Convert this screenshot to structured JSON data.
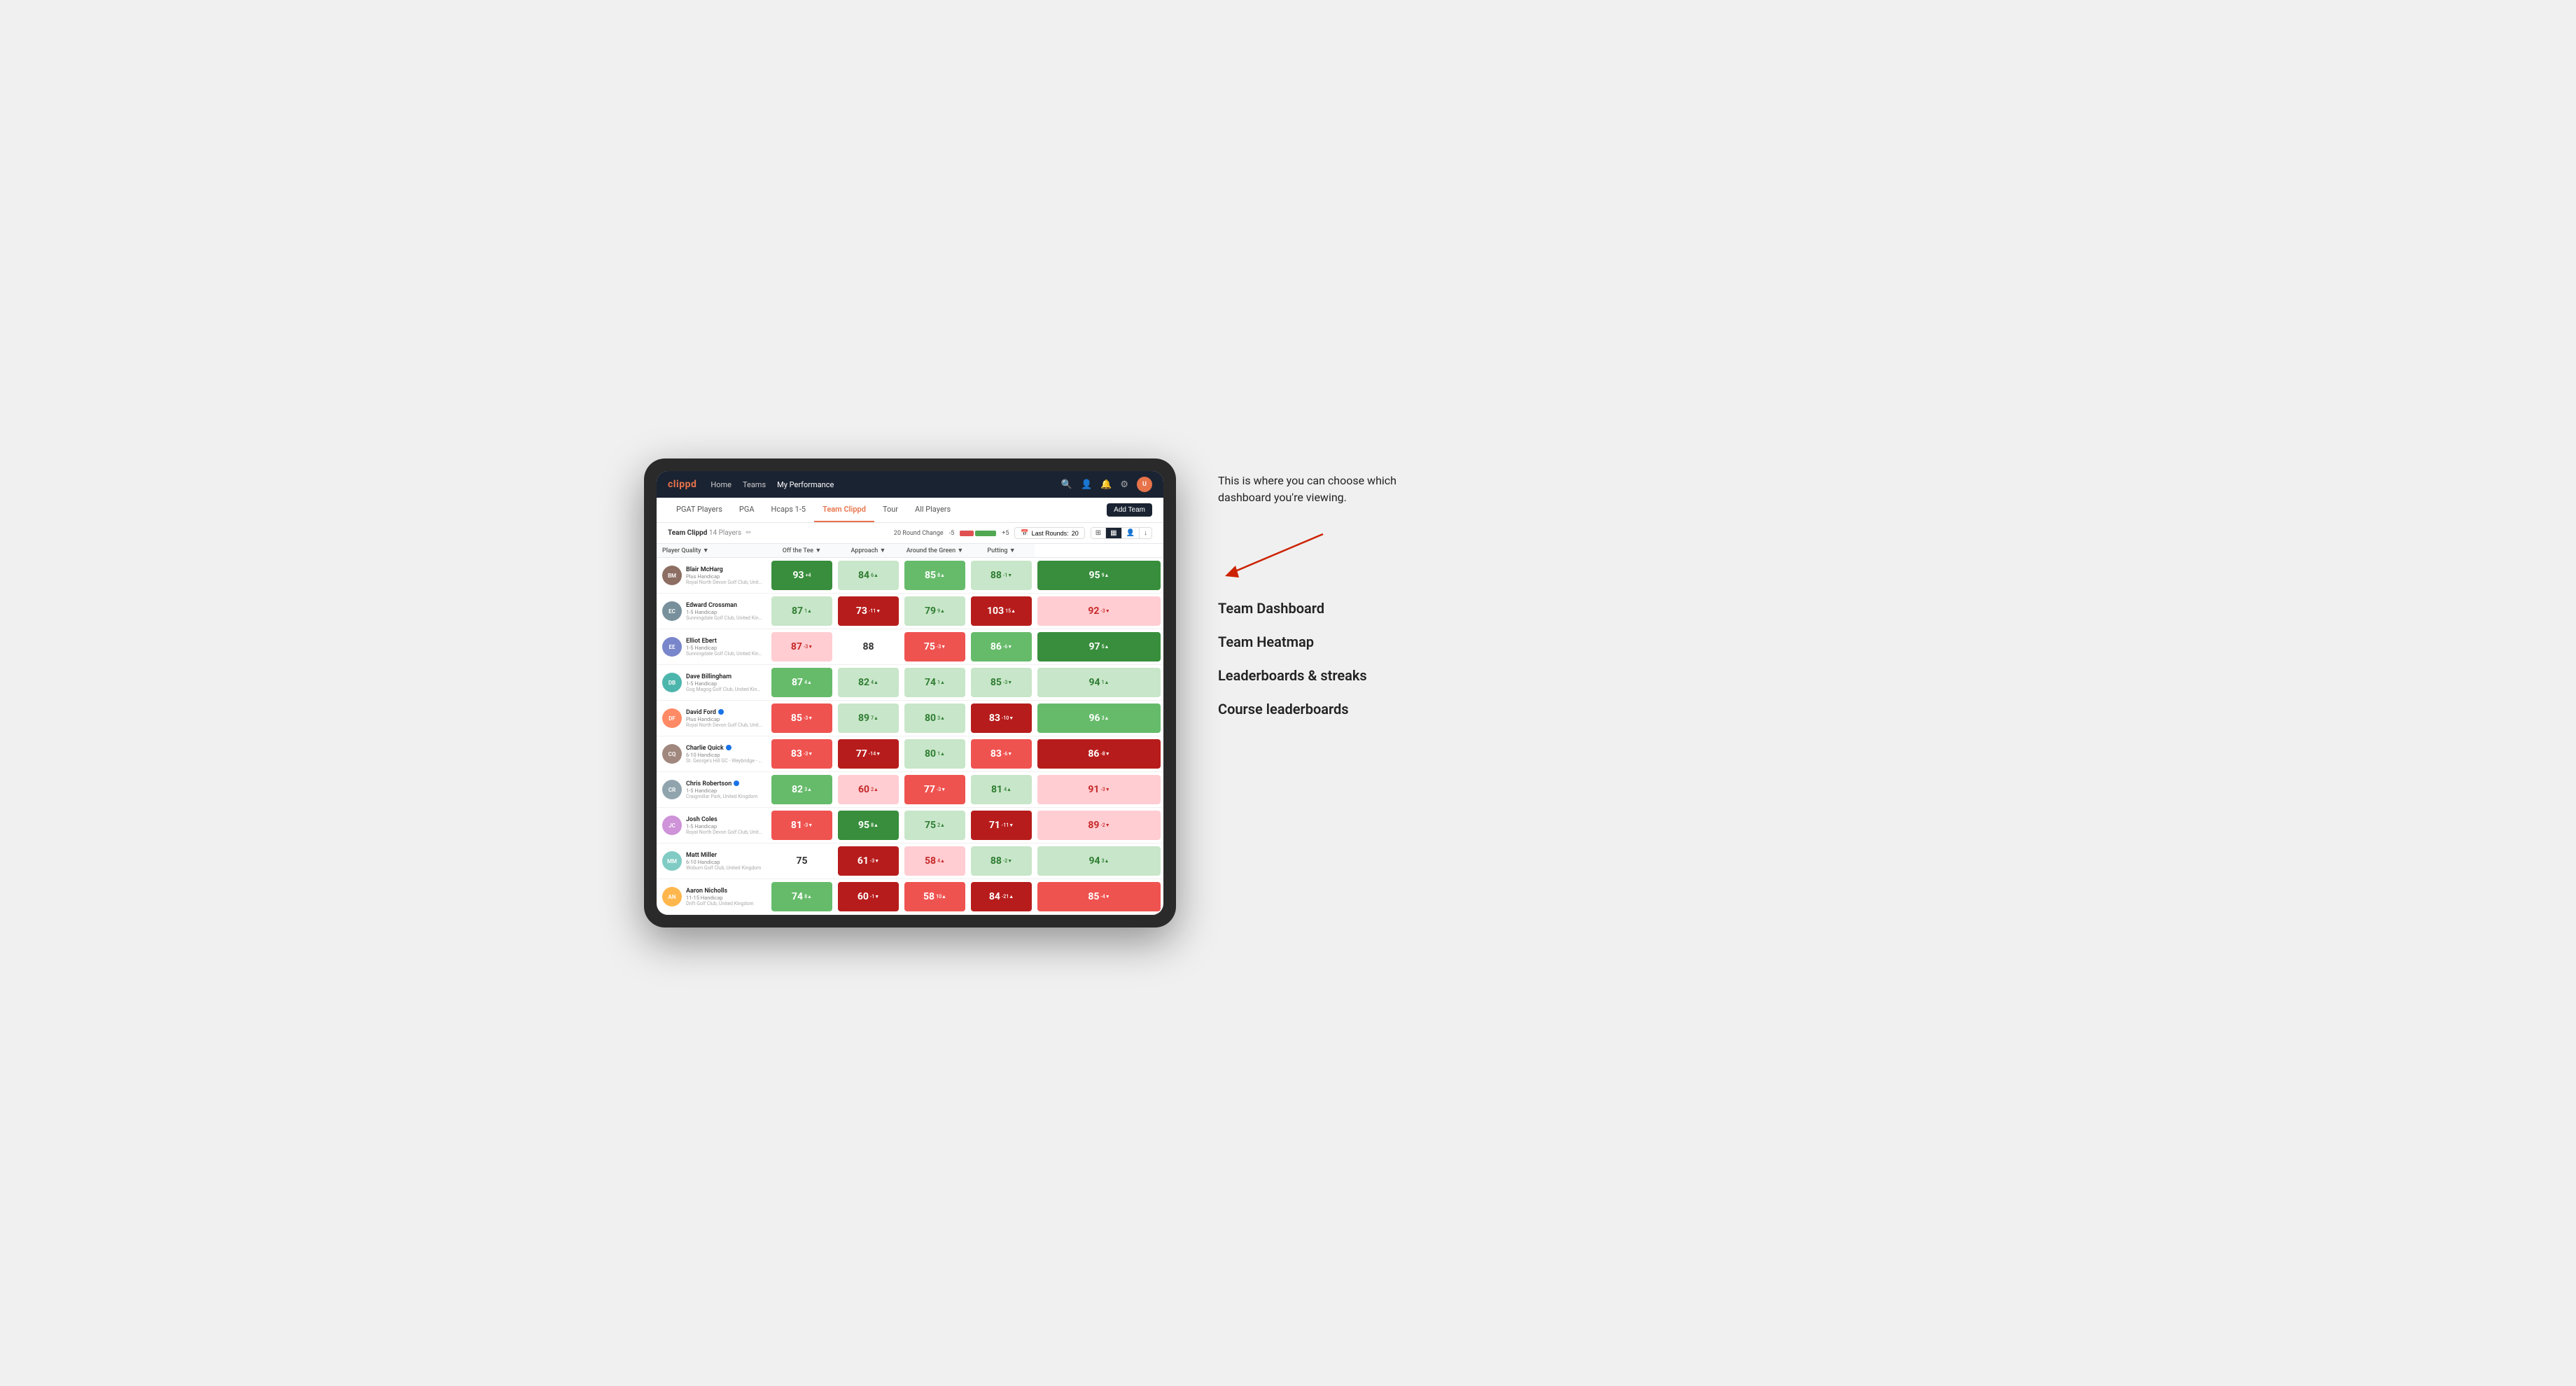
{
  "annotation": {
    "text": "This is where you can choose which dashboard you're viewing.",
    "arrow": "↙"
  },
  "dashboard_options": [
    {
      "label": "Team Dashboard"
    },
    {
      "label": "Team Heatmap"
    },
    {
      "label": "Leaderboards & streaks"
    },
    {
      "label": "Course leaderboards"
    }
  ],
  "nav": {
    "logo": "clippd",
    "links": [
      "Home",
      "Teams",
      "My Performance"
    ],
    "active_link": "My Performance"
  },
  "sub_nav": {
    "links": [
      "PGAT Players",
      "PGA",
      "Hcaps 1-5",
      "Team Clippd",
      "Tour",
      "All Players"
    ],
    "active_link": "Team Clippd",
    "add_team_label": "Add Team"
  },
  "team_header": {
    "title": "Team Clippd",
    "player_count": "14 Players",
    "round_change_label": "20 Round Change",
    "round_change_min": "-5",
    "round_change_max": "+5",
    "last_rounds_label": "Last Rounds:",
    "last_rounds_value": "20"
  },
  "columns": {
    "player": "Player Quality ▼",
    "off_tee": "Off the Tee ▼",
    "approach": "Approach ▼",
    "around_green": "Around the Green ▼",
    "putting": "Putting ▼"
  },
  "players": [
    {
      "name": "Blair McHarg",
      "handicap": "Plus Handicap",
      "club": "Royal North Devon Golf Club, United Kingdom",
      "quality": {
        "value": 93,
        "change": "+4",
        "dir": "up",
        "bg": "bg-dark-green"
      },
      "off_tee": {
        "value": 84,
        "change": "6▲",
        "dir": "up",
        "bg": "bg-light-green"
      },
      "approach": {
        "value": 85,
        "change": "8▲",
        "dir": "up",
        "bg": "bg-medium-green"
      },
      "around": {
        "value": 88,
        "change": "-1▼",
        "dir": "down",
        "bg": "bg-light-green"
      },
      "putting": {
        "value": 95,
        "change": "9▲",
        "dir": "up",
        "bg": "bg-dark-green"
      }
    },
    {
      "name": "Edward Crossman",
      "handicap": "1-5 Handicap",
      "club": "Sunningdale Golf Club, United Kingdom",
      "quality": {
        "value": 87,
        "change": "1▲",
        "dir": "up",
        "bg": "bg-light-green"
      },
      "off_tee": {
        "value": 73,
        "change": "-11▼",
        "dir": "down",
        "bg": "bg-dark-red"
      },
      "approach": {
        "value": 79,
        "change": "9▲",
        "dir": "up",
        "bg": "bg-light-green"
      },
      "around": {
        "value": 103,
        "change": "15▲",
        "dir": "up",
        "bg": "bg-dark-red"
      },
      "putting": {
        "value": 92,
        "change": "-3▼",
        "dir": "down",
        "bg": "bg-light-red"
      }
    },
    {
      "name": "Elliot Ebert",
      "handicap": "1-5 Handicap",
      "club": "Sunningdale Golf Club, United Kingdom",
      "quality": {
        "value": 87,
        "change": "-3▼",
        "dir": "down",
        "bg": "bg-light-red"
      },
      "off_tee": {
        "value": 88,
        "change": "",
        "dir": "",
        "bg": "bg-white"
      },
      "approach": {
        "value": 75,
        "change": "-3▼",
        "dir": "down",
        "bg": "bg-medium-red"
      },
      "around": {
        "value": 86,
        "change": "-6▼",
        "dir": "down",
        "bg": "bg-medium-green"
      },
      "putting": {
        "value": 97,
        "change": "5▲",
        "dir": "up",
        "bg": "bg-dark-green"
      }
    },
    {
      "name": "Dave Billingham",
      "handicap": "1-5 Handicap",
      "club": "Gog Magog Golf Club, United Kingdom",
      "quality": {
        "value": 87,
        "change": "4▲",
        "dir": "up",
        "bg": "bg-medium-green"
      },
      "off_tee": {
        "value": 82,
        "change": "4▲",
        "dir": "up",
        "bg": "bg-light-green"
      },
      "approach": {
        "value": 74,
        "change": "1▲",
        "dir": "up",
        "bg": "bg-light-green"
      },
      "around": {
        "value": 85,
        "change": "-3▼",
        "dir": "down",
        "bg": "bg-light-green"
      },
      "putting": {
        "value": 94,
        "change": "1▲",
        "dir": "up",
        "bg": "bg-light-green"
      }
    },
    {
      "name": "David Ford",
      "handicap": "Plus Handicap",
      "club": "Royal North Devon Golf Club, United Kingdom",
      "verified": true,
      "quality": {
        "value": 85,
        "change": "-3▼",
        "dir": "down",
        "bg": "bg-medium-red"
      },
      "off_tee": {
        "value": 89,
        "change": "7▲",
        "dir": "up",
        "bg": "bg-light-green"
      },
      "approach": {
        "value": 80,
        "change": "3▲",
        "dir": "up",
        "bg": "bg-light-green"
      },
      "around": {
        "value": 83,
        "change": "-10▼",
        "dir": "down",
        "bg": "bg-dark-red"
      },
      "putting": {
        "value": 96,
        "change": "3▲",
        "dir": "up",
        "bg": "bg-medium-green"
      }
    },
    {
      "name": "Charlie Quick",
      "handicap": "6-10 Handicap",
      "club": "St. George's Hill GC - Weybridge - Surrey, Uni...",
      "verified": true,
      "quality": {
        "value": 83,
        "change": "-3▼",
        "dir": "down",
        "bg": "bg-medium-red"
      },
      "off_tee": {
        "value": 77,
        "change": "-14▼",
        "dir": "down",
        "bg": "bg-dark-red"
      },
      "approach": {
        "value": 80,
        "change": "1▲",
        "dir": "up",
        "bg": "bg-light-green"
      },
      "around": {
        "value": 83,
        "change": "-6▼",
        "dir": "down",
        "bg": "bg-medium-red"
      },
      "putting": {
        "value": 86,
        "change": "-8▼",
        "dir": "down",
        "bg": "bg-dark-red"
      }
    },
    {
      "name": "Chris Robertson",
      "handicap": "1-5 Handicap",
      "club": "Craigmillar Park, United Kingdom",
      "verified": true,
      "quality": {
        "value": 82,
        "change": "3▲",
        "dir": "up",
        "bg": "bg-medium-green"
      },
      "off_tee": {
        "value": 60,
        "change": "2▲",
        "dir": "up",
        "bg": "bg-light-red"
      },
      "approach": {
        "value": 77,
        "change": "-3▼",
        "dir": "down",
        "bg": "bg-medium-red"
      },
      "around": {
        "value": 81,
        "change": "4▲",
        "dir": "up",
        "bg": "bg-light-green"
      },
      "putting": {
        "value": 91,
        "change": "-3▼",
        "dir": "down",
        "bg": "bg-light-red"
      }
    },
    {
      "name": "Josh Coles",
      "handicap": "1-5 Handicap",
      "club": "Royal North Devon Golf Club, United Kingdom",
      "quality": {
        "value": 81,
        "change": "-3▼",
        "dir": "down",
        "bg": "bg-medium-red"
      },
      "off_tee": {
        "value": 95,
        "change": "8▲",
        "dir": "up",
        "bg": "bg-dark-green"
      },
      "approach": {
        "value": 75,
        "change": "2▲",
        "dir": "up",
        "bg": "bg-light-green"
      },
      "around": {
        "value": 71,
        "change": "-11▼",
        "dir": "down",
        "bg": "bg-dark-red"
      },
      "putting": {
        "value": 89,
        "change": "-2▼",
        "dir": "down",
        "bg": "bg-light-red"
      }
    },
    {
      "name": "Matt Miller",
      "handicap": "6-10 Handicap",
      "club": "Woburn Golf Club, United Kingdom",
      "quality": {
        "value": 75,
        "change": "",
        "dir": "",
        "bg": "bg-white"
      },
      "off_tee": {
        "value": 61,
        "change": "-3▼",
        "dir": "down",
        "bg": "bg-dark-red"
      },
      "approach": {
        "value": 58,
        "change": "4▲",
        "dir": "up",
        "bg": "bg-light-red"
      },
      "around": {
        "value": 88,
        "change": "-2▼",
        "dir": "down",
        "bg": "bg-light-green"
      },
      "putting": {
        "value": 94,
        "change": "3▲",
        "dir": "up",
        "bg": "bg-light-green"
      }
    },
    {
      "name": "Aaron Nicholls",
      "handicap": "11-15 Handicap",
      "club": "Drift Golf Club, United Kingdom",
      "quality": {
        "value": 74,
        "change": "8▲",
        "dir": "up",
        "bg": "bg-medium-green"
      },
      "off_tee": {
        "value": 60,
        "change": "-1▼",
        "dir": "down",
        "bg": "bg-dark-red"
      },
      "approach": {
        "value": 58,
        "change": "10▲",
        "dir": "up",
        "bg": "bg-medium-red"
      },
      "around": {
        "value": 84,
        "change": "-21▲",
        "dir": "up",
        "bg": "bg-dark-red"
      },
      "putting": {
        "value": 85,
        "change": "-4▼",
        "dir": "down",
        "bg": "bg-medium-red"
      }
    }
  ]
}
